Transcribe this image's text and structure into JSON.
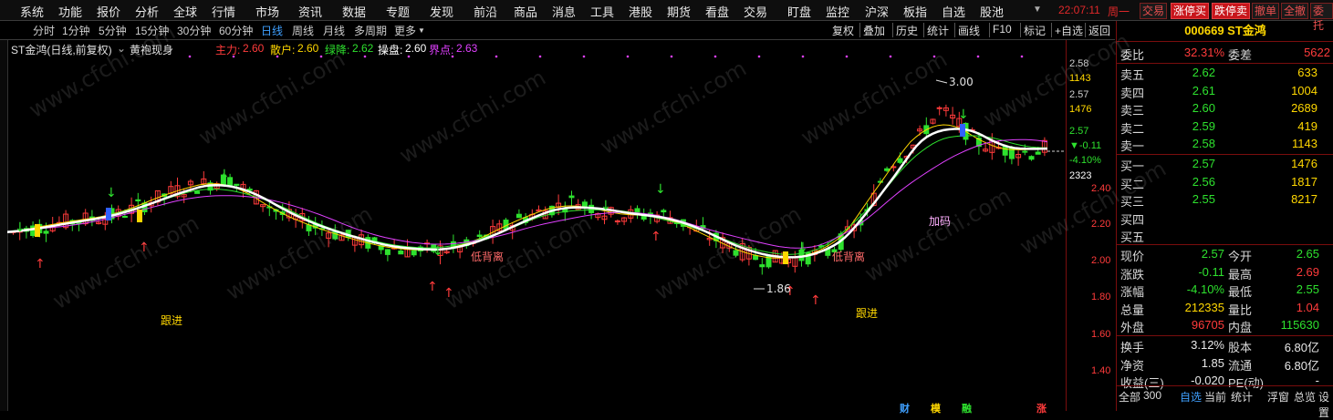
{
  "menu": [
    "系统",
    "功能",
    "报价",
    "分析",
    "全球",
    "行情",
    "市场",
    "资讯",
    "数据",
    "专题",
    "发现",
    "前沿",
    "商品",
    "消息",
    "工具",
    "港股",
    "期货",
    "看盘",
    "交易",
    "盯盘",
    "监控",
    "沪深",
    "板指",
    "自选",
    "股池"
  ],
  "clock": "22:07:11",
  "weekday": "周一",
  "top_buttons": [
    "交易",
    "涨停买",
    "跌停卖",
    "撤单",
    "全撤",
    "委托"
  ],
  "toolbar": {
    "tabs": [
      "分时",
      "1分钟",
      "5分钟",
      "15分钟",
      "30分钟",
      "60分钟",
      "日线",
      "周线",
      "月线",
      "多周期",
      "更多"
    ],
    "active_tab": "日线",
    "right": [
      "复权",
      "叠加",
      "历史",
      "统计",
      "画线",
      "F10",
      "标记",
      "+自选",
      "返回"
    ]
  },
  "indicator": {
    "name": "ST金鸿(日线,前复权)",
    "formula": "黄袍现身",
    "items": [
      {
        "label": "主力:",
        "value": "2.60",
        "color": "#ff3b3b"
      },
      {
        "label": "散户:",
        "value": "2.60",
        "color": "#ffd700"
      },
      {
        "label": "绿降:",
        "value": "2.62",
        "color": "#2ee12e"
      },
      {
        "label": "操盘:",
        "value": "2.60",
        "color": "#ffffff"
      },
      {
        "label": "界点:",
        "value": "2.63",
        "color": "#e040ff"
      }
    ]
  },
  "axis": {
    "ticks": [
      {
        "label": "2.58",
        "color": "#cfcfcf"
      },
      {
        "label": "1143",
        "color": "#ffd700"
      },
      {
        "label": "2.57",
        "color": "#cfcfcf"
      },
      {
        "label": "1476",
        "color": "#ffd700"
      },
      {
        "label": "2.57",
        "color": "#2ee12e"
      },
      {
        "label": "▼-0.11",
        "color": "#2ee12e"
      },
      {
        "label": "-4.10%",
        "color": "#2ee12e"
      },
      {
        "label": "2323",
        "color": "#ffffff"
      },
      {
        "label": "2.40",
        "color": "#ff3b3b"
      },
      {
        "label": "2.20",
        "color": "#ff3b3b"
      },
      {
        "label": "2.00",
        "color": "#ff3b3b"
      },
      {
        "label": "1.80",
        "color": "#ff3b3b"
      },
      {
        "label": "1.60",
        "color": "#ff3b3b"
      },
      {
        "label": "1.40",
        "color": "#ff3b3b"
      }
    ]
  },
  "chart_annotations": {
    "high_label": "3.00",
    "low_label": "1.86",
    "follow_left": "跟进",
    "follow_right": "跟进",
    "deviation_left": "低背离",
    "deviation_right": "低背离",
    "add_position": "加码",
    "watermark": "www.cfchi.com",
    "badges": [
      "财",
      "模",
      "融",
      "涨"
    ]
  },
  "panel": {
    "title": "000669 ST金鸿",
    "ratio": {
      "label": "委比",
      "value": "32.31%",
      "label2": "委差",
      "value2": "5622"
    },
    "asks": [
      {
        "label": "卖五",
        "price": "2.62",
        "vol": "633"
      },
      {
        "label": "卖四",
        "price": "2.61",
        "vol": "1004"
      },
      {
        "label": "卖三",
        "price": "2.60",
        "vol": "2689"
      },
      {
        "label": "卖二",
        "price": "2.59",
        "vol": "419"
      },
      {
        "label": "卖一",
        "price": "2.58",
        "vol": "1143"
      }
    ],
    "bids": [
      {
        "label": "买一",
        "price": "2.57",
        "vol": "1476"
      },
      {
        "label": "买二",
        "price": "2.56",
        "vol": "1817"
      },
      {
        "label": "买三",
        "price": "2.55",
        "vol": "8217"
      },
      {
        "label": "买四",
        "price": "",
        "vol": ""
      },
      {
        "label": "买五",
        "price": "",
        "vol": ""
      }
    ],
    "stats": [
      {
        "l1": "现价",
        "v1": "2.57",
        "c1": "#2ee12e",
        "l2": "今开",
        "v2": "2.65",
        "c2": "#2ee12e"
      },
      {
        "l1": "涨跌",
        "v1": "-0.11",
        "c1": "#2ee12e",
        "l2": "最高",
        "v2": "2.69",
        "c2": "#ff3b3b"
      },
      {
        "l1": "涨幅",
        "v1": "-4.10%",
        "c1": "#2ee12e",
        "l2": "最低",
        "v2": "2.55",
        "c2": "#2ee12e"
      },
      {
        "l1": "总量",
        "v1": "212335",
        "c1": "#ffd700",
        "l2": "量比",
        "v2": "1.04",
        "c2": "#ff3b3b"
      },
      {
        "l1": "外盘",
        "v1": "96705",
        "c1": "#ff3b3b",
        "l2": "内盘",
        "v2": "115630",
        "c2": "#2ee12e"
      }
    ],
    "stats2": [
      {
        "l1": "换手",
        "v1": "3.12%",
        "l2": "股本",
        "v2": "6.80亿"
      },
      {
        "l1": "净资",
        "v1": "1.85",
        "l2": "流通",
        "v2": "6.80亿"
      },
      {
        "l1": "收益(三)",
        "v1": "-0.020",
        "l2": "PE(动)",
        "v2": "-"
      }
    ],
    "bottom_tabs": [
      "全部",
      "300",
      "自选",
      "当前",
      "统计",
      "浮窗",
      "总览",
      "设置"
    ],
    "active_bottom": "自选"
  },
  "colors": {
    "up": "#ff3b3b",
    "down": "#2ee12e",
    "accent": "#3fa0ff",
    "border": "#7a0d0d"
  }
}
